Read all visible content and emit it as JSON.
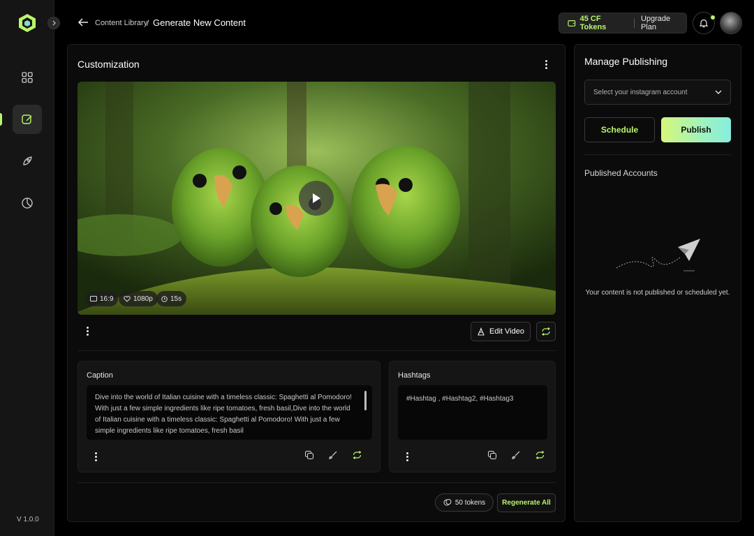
{
  "app": {
    "version": "V 1.0.0"
  },
  "header": {
    "breadcrumb_parent": "Content Library",
    "breadcrumb_separator": "/",
    "page_title": "Generate New Content",
    "tokens_label": "45 CF Tokens",
    "upgrade_label": "Upgrade Plan"
  },
  "sidebar": {
    "items": [
      {
        "name": "dashboard",
        "icon": "grid-icon",
        "active": false
      },
      {
        "name": "create",
        "icon": "edit-square-icon",
        "active": true
      },
      {
        "name": "publish",
        "icon": "rocket-icon",
        "active": false
      },
      {
        "name": "analytics",
        "icon": "pie-chart-icon",
        "active": false
      }
    ]
  },
  "customization": {
    "title": "Customization",
    "video": {
      "aspect_ratio": "16:9",
      "resolution": "1080p",
      "duration": "15s"
    },
    "edit_video_label": "Edit Video",
    "caption": {
      "title": "Caption",
      "text": "Dive into the world of Italian cuisine with a timeless classic: Spaghetti al Pomodoro! With just a few simple ingredients like ripe tomatoes, fresh basil,Dive into the world of Italian cuisine with a timeless classic: Spaghetti al Pomodoro! With just a few simple ingredients like ripe tomatoes, fresh basil"
    },
    "hashtags": {
      "title": "Hashtags",
      "text": "#Hashtag , #Hashtag2, #Hashtag3"
    },
    "tokens_cost": "50 tokens",
    "regenerate_all_label": "Regenerate All"
  },
  "publishing": {
    "title": "Manage Publishing",
    "account_select_placeholder": "Select your instagram account",
    "schedule_label": "Schedule",
    "publish_label": "Publish",
    "published_accounts_title": "Published Accounts",
    "empty_message": "Your content is not published or scheduled yet."
  },
  "colors": {
    "accent": "#b9f56a",
    "publish_gradient_start": "#d6f77a",
    "publish_gradient_end": "#86eede",
    "background": "#000000",
    "panel": "#0b0b0b"
  }
}
